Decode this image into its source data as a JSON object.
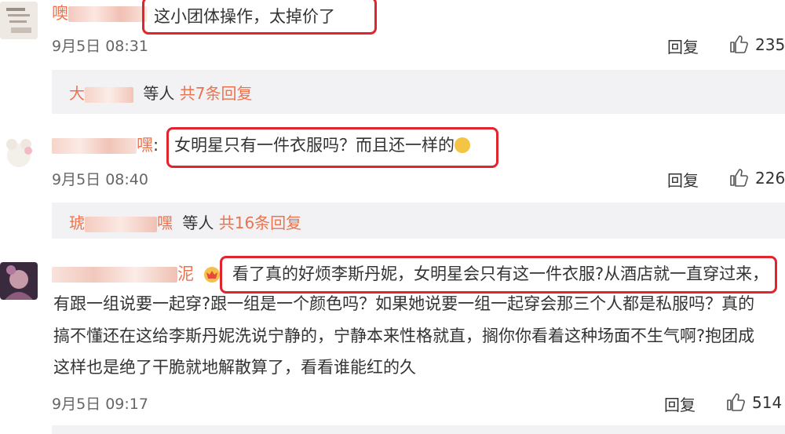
{
  "comments": [
    {
      "username_text": "噢",
      "text": "这小团体操作，太掉价了",
      "time": "9月5日 08:31",
      "reply_label": "回复",
      "likes": "235",
      "replies": {
        "name": "大",
        "others": "等人",
        "count": "共7条回复"
      }
    },
    {
      "username_text": "嘿",
      "text": "女明星只有一件衣服吗？而且还一样的",
      "time": "9月5日 08:40",
      "reply_label": "回复",
      "likes": "226",
      "replies": {
        "name": "琥",
        "name_tail": "嘿",
        "others": "等人",
        "count": "共16条回复"
      }
    },
    {
      "username_text": "泥",
      "lines": [
        "看了真的好烦李斯丹妮，女明星会只有这一件衣服?从酒店就一直穿过来，",
        "有跟一组说要一起穿?跟一组是一个颜色吗？如果她说要一组一起穿会那三个人都是私服吗？真的",
        "搞不懂还在这给李斯丹妮洗说宁静的，宁静本来性格就直，搁你你看着这种场面不生气啊?抱团成",
        "这样也是绝了干脆就地解散算了，看看谁能红的久"
      ],
      "time": "9月5日 09:17",
      "reply_label": "回复",
      "likes": "514"
    }
  ],
  "colors": {
    "accent": "#eb7350",
    "highlight": "#e0252f",
    "reply_bg": "#f2f2f5"
  },
  "icons": {
    "like": "thumbs-up-icon",
    "emoji": "thinking-face-icon",
    "badge": "crown-icon"
  }
}
